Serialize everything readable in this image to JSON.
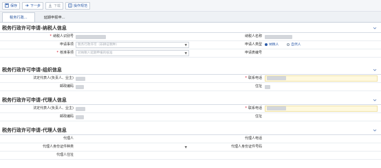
{
  "toolbar": {
    "save": "保存",
    "next": "下一步",
    "download": "下载",
    "help": "操作规范"
  },
  "tabs": [
    {
      "label": "税务行政..."
    },
    {
      "label": "延期申报申..."
    }
  ],
  "sections": {
    "taxpayer": {
      "title": "税务行政许可申请-纳税人信息",
      "taxpayer_id_label": "纳税人识别号",
      "taxpayer_name_label": "纳税人名称",
      "apply_item_label": "申请事项",
      "apply_item_placeholder": "税务行政许可（非耕征税种）",
      "applicant_type_label": "申请人类型",
      "applicant_type_options": [
        "纳税人",
        "自然人"
      ],
      "approval_item_label": "核准事项",
      "approval_item_placeholder": "对纳税人延期申报的核准",
      "apply_no_label": "申请表编号"
    },
    "org": {
      "title": "税务行政许可申请-组织信息",
      "legal_rep_label": "法定代表人(负责人、业主)",
      "phone_label": "联系电话",
      "postcode_label": "邮政编码",
      "address_label": "住址"
    },
    "agent": {
      "title": "税务行政许可申请-代理人信息",
      "legal_rep_label": "法定代表人(负责人、业主)",
      "phone_label": "联系电话",
      "postcode_label": "邮政编码",
      "address_label": "住址"
    },
    "agent_person": {
      "title": "税务行政许可申请-代理人信息",
      "agent_label": "代理人",
      "agent_phone_label": "代理人电话",
      "id_type_label": "代理人身份证件种类",
      "id_no_label": "代理人身份证件号码",
      "agent_address_label": "代理人住址"
    }
  },
  "colors": {
    "required": "#d0021b",
    "accent": "#2a5aa8",
    "highlight_field": "#fff9de"
  }
}
